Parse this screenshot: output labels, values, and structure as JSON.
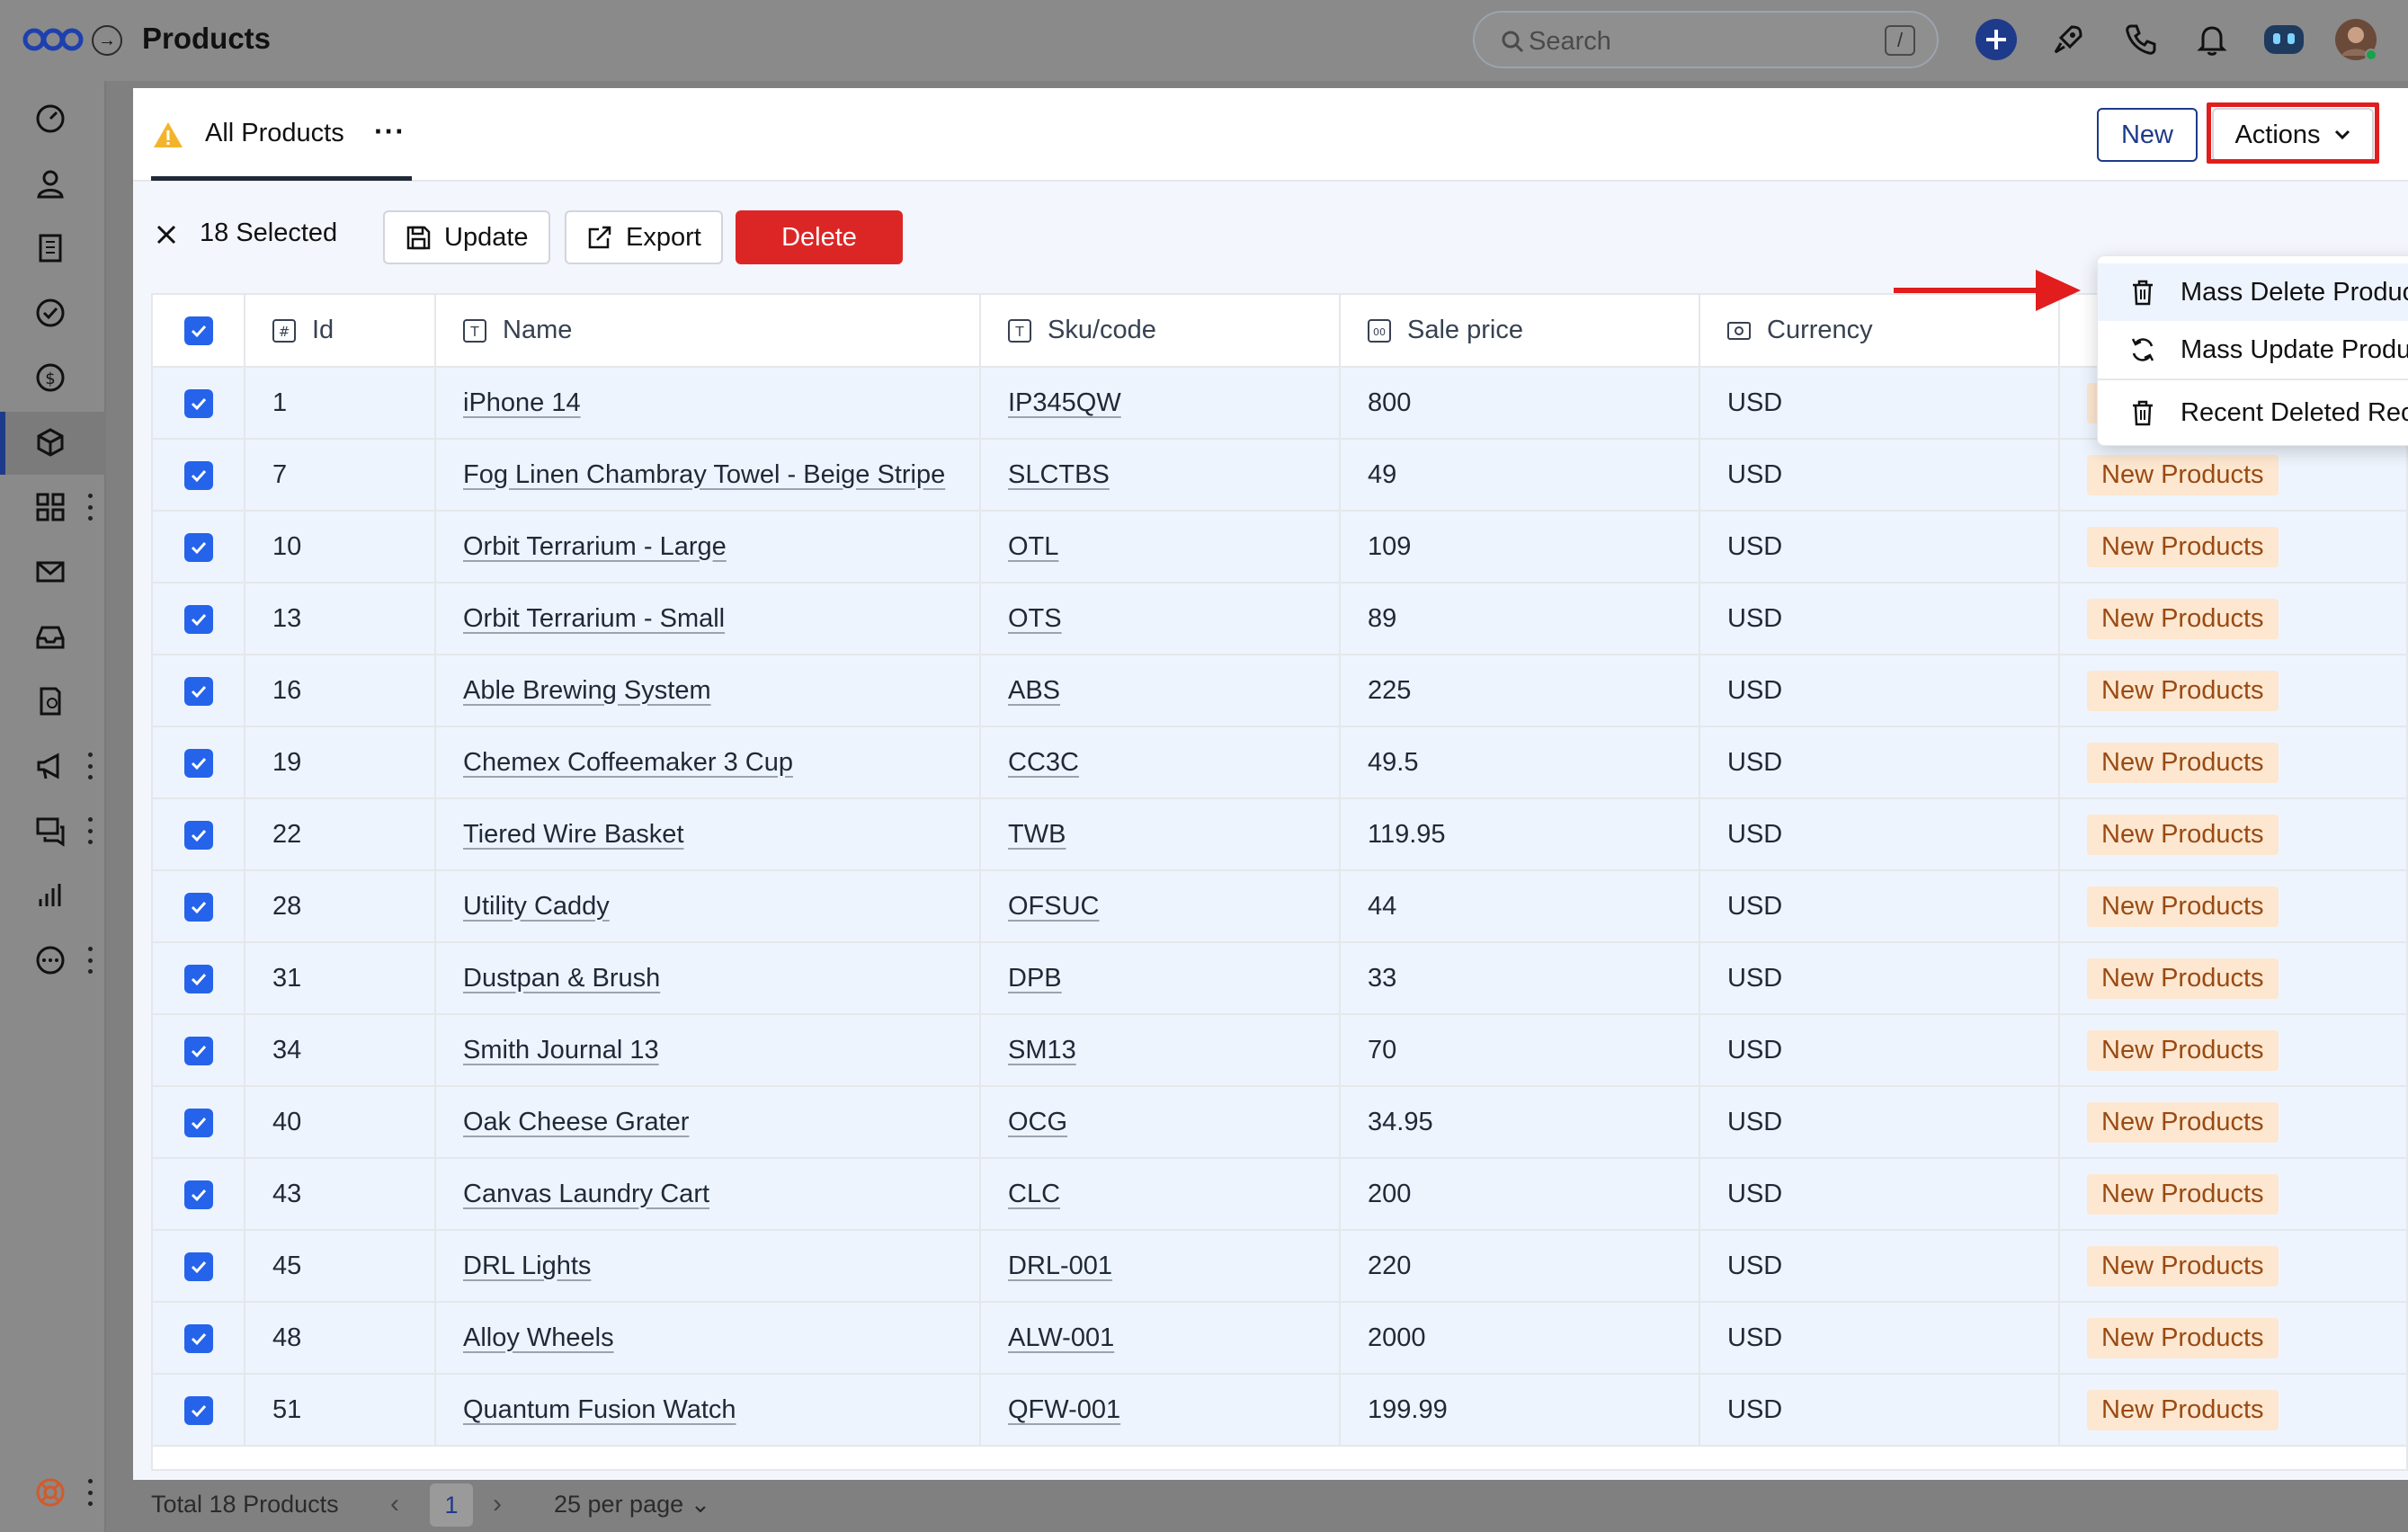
{
  "header": {
    "title": "Products",
    "search_placeholder": "Search",
    "search_shortcut": "/"
  },
  "tab": {
    "label": "All Products",
    "more": "···"
  },
  "toolbar": {
    "new_label": "New",
    "actions_label": "Actions"
  },
  "selection": {
    "count_label": "18 Selected",
    "update_label": "Update",
    "export_label": "Export",
    "delete_label": "Delete"
  },
  "actions_menu": {
    "items": [
      {
        "label": "Mass Delete Products",
        "icon": "trash-icon"
      },
      {
        "label": "Mass Update Products",
        "icon": "refresh-icon"
      },
      {
        "label": "Recent Deleted Records",
        "icon": "trash-icon"
      }
    ]
  },
  "table": {
    "columns": [
      "Id",
      "Name",
      "Sku/code",
      "Sale price",
      "Currency"
    ],
    "rows": [
      {
        "id": "1",
        "name": "iPhone 14",
        "sku": "IP345QW",
        "price": "800",
        "currency": "USD",
        "tag": "New Products"
      },
      {
        "id": "7",
        "name": "Fog Linen Chambray Towel - Beige Stripe",
        "sku": "SLCTBS",
        "price": "49",
        "currency": "USD",
        "tag": "New Products"
      },
      {
        "id": "10",
        "name": "Orbit Terrarium - Large",
        "sku": "OTL",
        "price": "109",
        "currency": "USD",
        "tag": "New Products"
      },
      {
        "id": "13",
        "name": "Orbit Terrarium - Small",
        "sku": "OTS",
        "price": "89",
        "currency": "USD",
        "tag": "New Products"
      },
      {
        "id": "16",
        "name": "Able Brewing System",
        "sku": "ABS",
        "price": "225",
        "currency": "USD",
        "tag": "New Products"
      },
      {
        "id": "19",
        "name": "Chemex Coffeemaker 3 Cup",
        "sku": "CC3C",
        "price": "49.5",
        "currency": "USD",
        "tag": "New Products"
      },
      {
        "id": "22",
        "name": "Tiered Wire Basket",
        "sku": "TWB",
        "price": "119.95",
        "currency": "USD",
        "tag": "New Products"
      },
      {
        "id": "28",
        "name": "Utility Caddy",
        "sku": "OFSUC",
        "price": "44",
        "currency": "USD",
        "tag": "New Products"
      },
      {
        "id": "31",
        "name": "Dustpan & Brush",
        "sku": "DPB",
        "price": "33",
        "currency": "USD",
        "tag": "New Products"
      },
      {
        "id": "34",
        "name": "Smith Journal 13",
        "sku": "SM13",
        "price": "70",
        "currency": "USD",
        "tag": "New Products"
      },
      {
        "id": "40",
        "name": "Oak Cheese Grater",
        "sku": "OCG",
        "price": "34.95",
        "currency": "USD",
        "tag": "New Products"
      },
      {
        "id": "43",
        "name": "Canvas Laundry Cart",
        "sku": "CLC",
        "price": "200",
        "currency": "USD",
        "tag": "New Products"
      },
      {
        "id": "45",
        "name": "DRL Lights",
        "sku": "DRL-001",
        "price": "220",
        "currency": "USD",
        "tag": "New Products"
      },
      {
        "id": "48",
        "name": "Alloy Wheels",
        "sku": "ALW-001",
        "price": "2000",
        "currency": "USD",
        "tag": "New Products"
      },
      {
        "id": "51",
        "name": "Quantum Fusion Watch",
        "sku": "QFW-001",
        "price": "199.99",
        "currency": "USD",
        "tag": "New Products"
      }
    ]
  },
  "footer": {
    "total_label": "Total 18 Products",
    "current_page": "1",
    "per_page_label": "25 per page"
  },
  "colors": {
    "accent": "#2563eb",
    "brand_navy": "#1e3a8a",
    "delete": "#dc2626",
    "highlight": "#e11d1d",
    "tag_bg": "#fde7d0"
  }
}
